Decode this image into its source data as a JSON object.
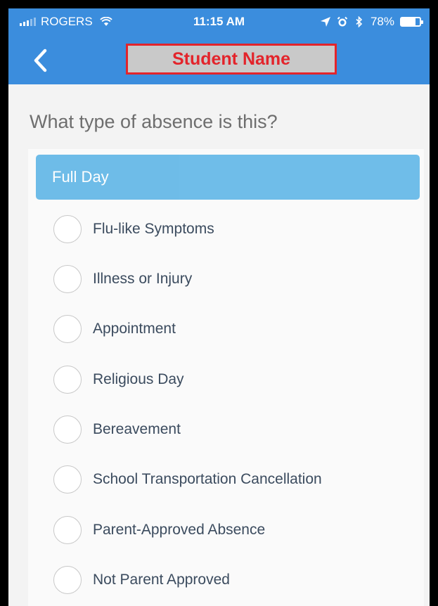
{
  "status_bar": {
    "carrier": "ROGERS",
    "time": "11:15 AM",
    "battery_percent_label": "78%",
    "battery_level": 0.78
  },
  "nav": {
    "back_icon": "chevron-left-icon",
    "title": "Student Name"
  },
  "question": "What type of absence is this?",
  "section_header": "Full Day",
  "options": [
    "Flu-like Symptoms",
    "Illness or Injury",
    "Appointment",
    "Religious Day",
    "Bereavement",
    "School Transportation Cancellation",
    "Parent-Approved Absence",
    "Not Parent Approved"
  ],
  "colors": {
    "app_bar": "#3b8ddd",
    "section_header": "#5fb6e7",
    "highlight_border": "#e3242b"
  }
}
